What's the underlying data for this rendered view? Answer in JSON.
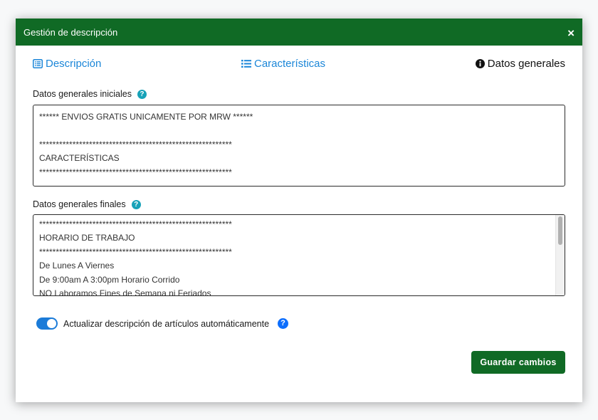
{
  "modal": {
    "title": "Gestión de descripción",
    "close_label": "×"
  },
  "tabs": [
    {
      "label": "Descripción",
      "icon": "list-alt-icon",
      "active": false
    },
    {
      "label": "Características",
      "icon": "list-icon",
      "active": false
    },
    {
      "label": "Datos generales",
      "icon": "info-circle-icon",
      "active": true
    }
  ],
  "initial": {
    "label": "Datos generales iniciales",
    "lines": [
      "****** ENVIOS GRATIS UNICAMENTE POR MRW ******",
      "",
      "**********************************************************",
      "CARACTERÍSTICAS",
      "**********************************************************"
    ]
  },
  "final": {
    "label": "Datos generales finales",
    "lines": [
      "**********************************************************",
      "HORARIO DE TRABAJO",
      "**********************************************************",
      "De Lunes A Viernes",
      "De 9:00am A 3:00pm Horario Corrido",
      "NO Laboramos Fines de Semana ni Feriados"
    ]
  },
  "auto_update": {
    "label": "Actualizar descripción de artículos automáticamente",
    "enabled": true
  },
  "save_label": "Guardar cambios",
  "colors": {
    "header": "#106a25",
    "link": "#1b86d8",
    "toggle": "#1b7bd8",
    "help_teal": "#17a2b8",
    "help_blue": "#0d6efd"
  }
}
